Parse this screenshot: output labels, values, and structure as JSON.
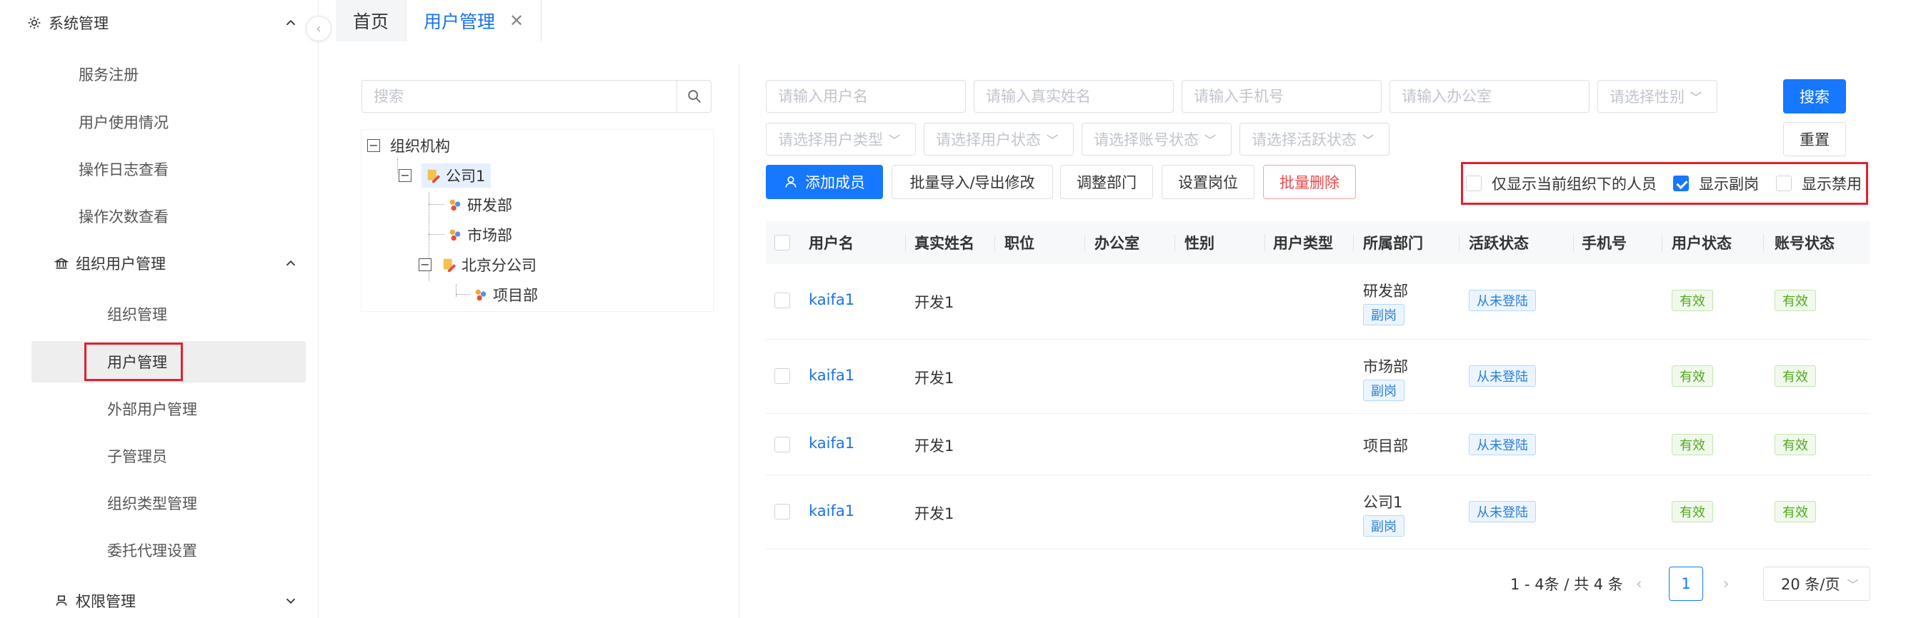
{
  "sidebar": {
    "system_label": "系统管理",
    "items_top": [
      "服务注册",
      "用户使用情况",
      "操作日志查看",
      "操作次数查看"
    ],
    "org_group_label": "组织用户管理",
    "org_items": [
      "组织管理",
      "用户管理",
      "外部用户管理",
      "子管理员",
      "组织类型管理",
      "委托代理设置"
    ],
    "perm_label": "权限管理"
  },
  "tabs": [
    {
      "label": "首页"
    },
    {
      "label": "用户管理"
    }
  ],
  "tree": {
    "search_placeholder": "搜索",
    "root": "组织机构",
    "company1": "公司1",
    "rd": "研发部",
    "market": "市场部",
    "beijing": "北京分公司",
    "project": "项目部"
  },
  "filters": {
    "username_ph": "请输入用户名",
    "realname_ph": "请输入真实姓名",
    "phone_ph": "请输入手机号",
    "office_ph": "请输入办公室",
    "gender_ph": "请选择性别",
    "usertype_ph": "请选择用户类型",
    "userstatus_ph": "请选择用户状态",
    "accountstatus_ph": "请选择账号状态",
    "activestatus_ph": "请选择活跃状态",
    "search_btn": "搜索",
    "reset_btn": "重置"
  },
  "actions": {
    "add_member": "添加成员",
    "batch_import": "批量导入/导出修改",
    "adjust_dept": "调整部门",
    "set_post": "设置岗位",
    "batch_delete": "批量删除"
  },
  "options": {
    "only_current": "仅显示当前组织下的人员",
    "show_secondary": "显示副岗",
    "show_disabled": "显示禁用"
  },
  "table": {
    "headers": [
      "用户名",
      "真实姓名",
      "职位",
      "办公室",
      "性别",
      "用户类型",
      "所属部门",
      "活跃状态",
      "手机号",
      "用户状态",
      "账号状态"
    ],
    "rows": [
      {
        "username": "kaifa1",
        "realname": "开发1",
        "dept": "研发部",
        "dept_tag": "副岗",
        "active": "从未登陆",
        "user_status": "有效",
        "account_status": "有效"
      },
      {
        "username": "kaifa1",
        "realname": "开发1",
        "dept": "市场部",
        "dept_tag": "副岗",
        "active": "从未登陆",
        "user_status": "有效",
        "account_status": "有效"
      },
      {
        "username": "kaifa1",
        "realname": "开发1",
        "dept": "项目部",
        "dept_tag": "",
        "active": "从未登陆",
        "user_status": "有效",
        "account_status": "有效"
      },
      {
        "username": "kaifa1",
        "realname": "开发1",
        "dept": "公司1",
        "dept_tag": "副岗",
        "active": "从未登陆",
        "user_status": "有效",
        "account_status": "有效"
      }
    ]
  },
  "pagination": {
    "summary": "1 - 4条 / 共 4 条",
    "current_page": "1",
    "page_size": "20 条/页"
  },
  "colors": {
    "primary": "#1677ff",
    "danger": "#f04848",
    "highlight_box": "#e0202e"
  }
}
